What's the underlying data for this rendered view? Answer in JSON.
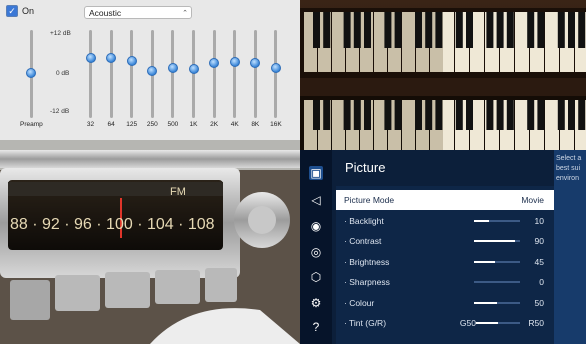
{
  "eq": {
    "on_label": "On",
    "preset": "Acoustic",
    "db_top": "+12 dB",
    "db_mid": "0 dB",
    "db_bot": "-12 dB",
    "preamp_label": "Preamp",
    "bands": [
      "32",
      "64",
      "125",
      "250",
      "500",
      "1K",
      "2K",
      "4K",
      "8K",
      "16K"
    ]
  },
  "radio": {
    "dial_text": "88 · 92 · 96 · 100 · 104 · 108",
    "fm_label": "FM"
  },
  "tv": {
    "title": "Picture",
    "side_note": "Select a best sui environ",
    "rows": [
      {
        "label": "Picture Mode",
        "value": "Movie"
      },
      {
        "label": "· Backlight",
        "value": "10"
      },
      {
        "label": "· Contrast",
        "value": "90"
      },
      {
        "label": "· Brightness",
        "value": "45"
      },
      {
        "label": "· Sharpness",
        "value": "0"
      },
      {
        "label": "· Colour",
        "value": "50"
      },
      {
        "label": "· Tint (G/R)",
        "value": "R50",
        "left": "G50"
      }
    ]
  }
}
